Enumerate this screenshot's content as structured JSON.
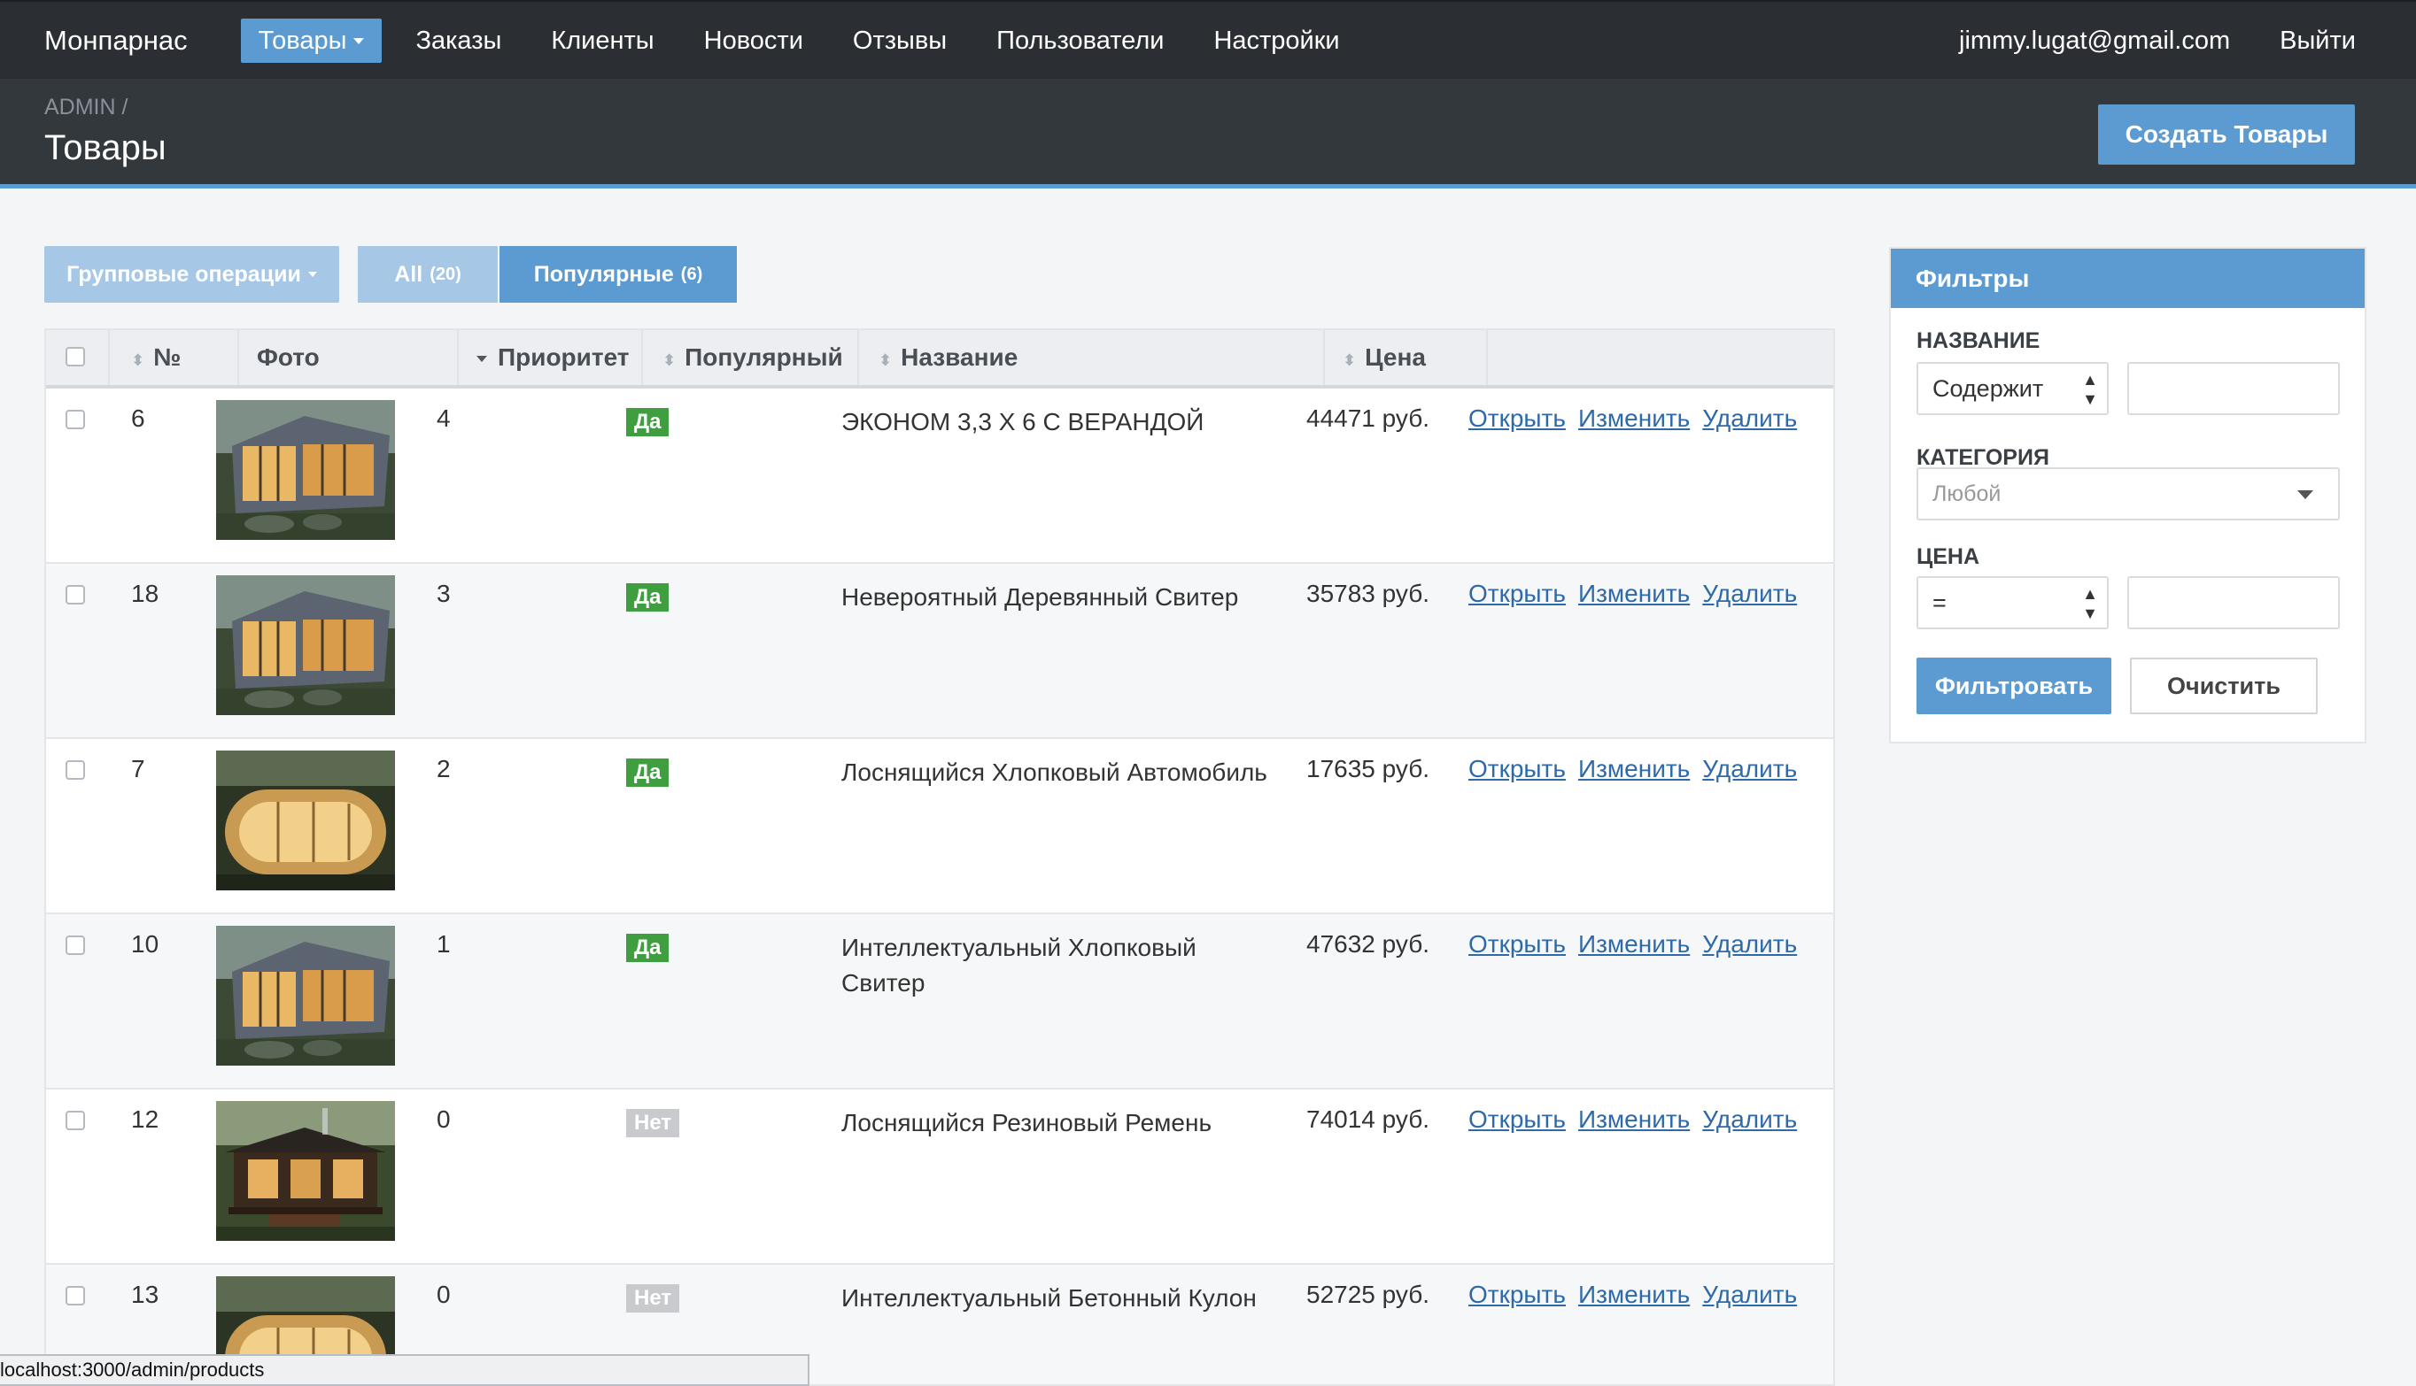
{
  "nav": {
    "brand": "Монпарнас",
    "items": [
      "Товары",
      "Заказы",
      "Клиенты",
      "Новости",
      "Отзывы",
      "Пользователи",
      "Настройки"
    ],
    "user_email": "jimmy.lugat@gmail.com",
    "logout": "Выйти"
  },
  "header": {
    "breadcrumb": "ADMIN /",
    "title": "Товары",
    "create_button": "Создать Товары"
  },
  "toolbar": {
    "batch_actions": "Групповые операции",
    "scope_all": "All",
    "scope_all_count": "(20)",
    "scope_popular": "Популярные",
    "scope_popular_count": "(6)"
  },
  "table": {
    "columns": [
      "№",
      "Фото",
      "Приоритет",
      "Популярный",
      "Название",
      "Цена"
    ],
    "action_labels": [
      "Открыть",
      "Изменить",
      "Удалить"
    ],
    "rows": [
      {
        "id": "6",
        "priority": "4",
        "popular": "Да",
        "name": "ЭКОНОМ 3,3 Х 6 С ВЕРАНДОЙ",
        "price": "44471 руб.",
        "photo": "glass-cabin"
      },
      {
        "id": "18",
        "priority": "3",
        "popular": "Да",
        "name": "Невероятный Деревянный Свитер",
        "price": "35783 руб.",
        "photo": "glass-cabin"
      },
      {
        "id": "7",
        "priority": "2",
        "popular": "Да",
        "name": "Лоснящийся Хлопковый Автомобиль",
        "price": "17635 руб.",
        "photo": "capsule-pod"
      },
      {
        "id": "10",
        "priority": "1",
        "popular": "Да",
        "name": "Интеллектуальный Хлопковый Свитер",
        "price": "47632 руб.",
        "photo": "glass-cabin"
      },
      {
        "id": "12",
        "priority": "0",
        "popular": "Нет",
        "name": "Лоснящийся Резиновый Ремень",
        "price": "74014 руб.",
        "photo": "forest-house"
      },
      {
        "id": "13",
        "priority": "0",
        "popular": "Нет",
        "name": "Интеллектуальный Бетонный Кулон",
        "price": "52725 руб.",
        "photo": "capsule-pod"
      }
    ]
  },
  "filters": {
    "title": "Фильтры",
    "name_label": "НАЗВАНИЕ",
    "name_op": "Содержит",
    "name_value": "",
    "category_label": "КАТЕГОРИЯ",
    "category_value": "Любой",
    "price_label": "ЦЕНА",
    "price_op": "=",
    "price_value": "",
    "apply": "Фильтровать",
    "clear": "Очистить"
  },
  "status_url": "localhost:3000/admin/products",
  "colors": {
    "nav_bg": "#2b2f33",
    "header_bg": "#33383d",
    "accent": "#5b9bd1",
    "yes_badge": "#3f9e3f",
    "no_badge": "#c8cacd",
    "link": "#2e6aa9"
  }
}
